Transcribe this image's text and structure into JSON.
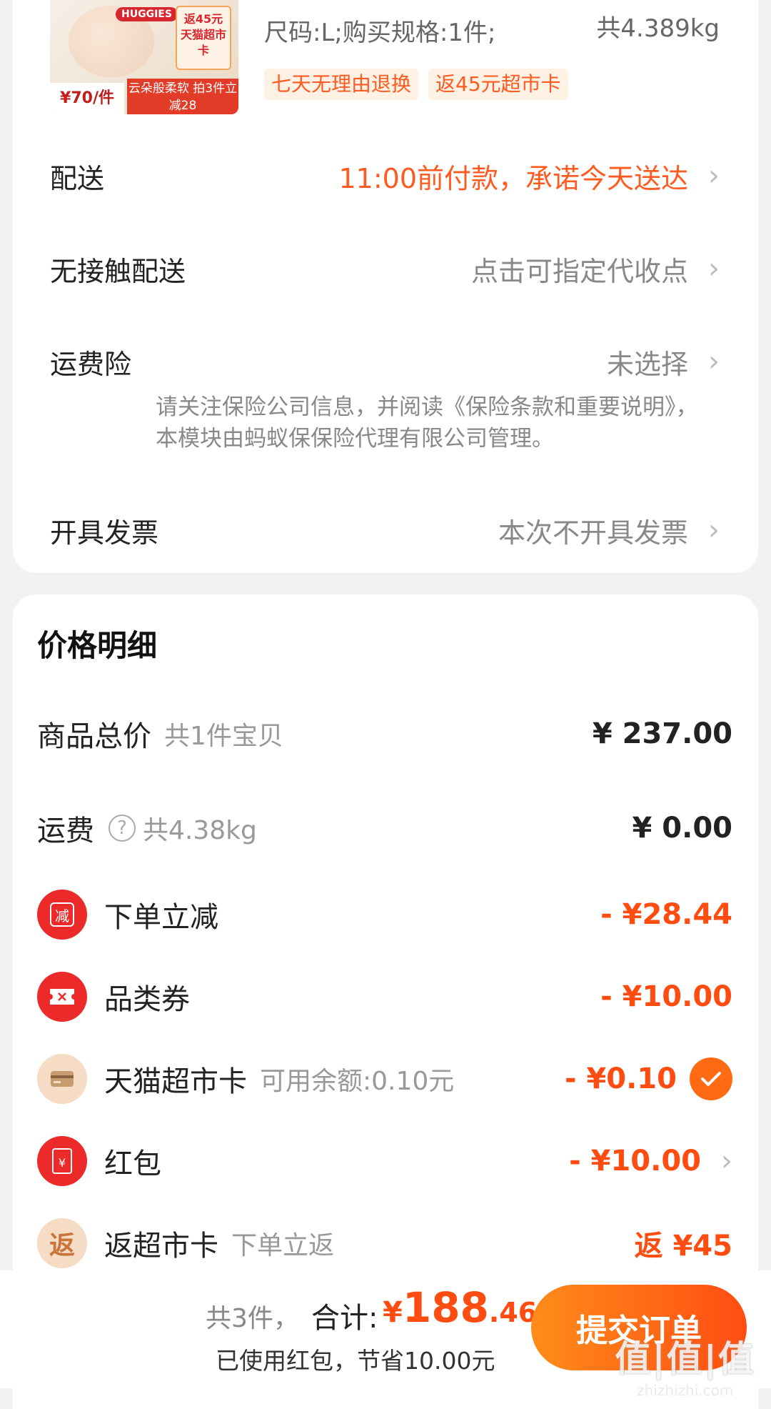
{
  "product": {
    "thumb_brand": "HUGGIES",
    "thumb_promo": "返45元 天猫超市卡",
    "thumb_price": "¥70/件",
    "thumb_ribbon": "云朵般柔软 拍3件立减28",
    "spec": "尺码:L;购买规格:1件;",
    "weight": "共4.389kg",
    "tags": [
      "七天无理由退换",
      "返45元超市卡"
    ]
  },
  "order_options": [
    {
      "label": "配送",
      "value": "11:00前付款，承诺今天送达",
      "accent": true
    },
    {
      "label": "无接触配送",
      "value": "点击可指定代收点",
      "accent": false
    },
    {
      "label": "运费险",
      "value": "未选择",
      "accent": false
    },
    {
      "label": "开具发票",
      "value": "本次不开具发票",
      "accent": false
    }
  ],
  "insurance_notice": "请关注保险公司信息，并阅读《保险条款和重要说明》，本模块由蚂蚁保保险代理有限公司管理。",
  "price_detail": {
    "title": "价格明细",
    "goods_total": {
      "label": "商品总价",
      "sub": "共1件宝贝",
      "amount": "¥ 237.00"
    },
    "shipping": {
      "label": "运费",
      "help_icon": "?",
      "sub": "共4.38kg",
      "amount": "¥ 0.00"
    },
    "discounts": [
      {
        "icon": "减",
        "label": "下单立减",
        "sub": "",
        "amount": "- ¥28.44"
      },
      {
        "icon": "coupon-icon",
        "label": "品类券",
        "sub": "",
        "amount": "- ¥10.00"
      },
      {
        "icon": "card-icon",
        "label": "天猫超市卡",
        "sub": "可用余额:0.10元",
        "amount": "- ¥0.10"
      },
      {
        "icon": "¥",
        "label": "红包",
        "sub": "",
        "amount": "- ¥10.00"
      },
      {
        "icon": "返",
        "label": "返超市卡",
        "sub": "下单立返",
        "amount": "返 ¥45"
      }
    ]
  },
  "bottom_bar": {
    "count": "共3件，",
    "total_label": "合计:",
    "currency": "¥",
    "price_int": "188",
    "price_dec": ".46",
    "saved": "已使用红包，节省10.00元",
    "submit_label": "提交订单"
  },
  "watermark": {
    "big": "值|值|值",
    "small": "zhizhizhi.com"
  },
  "colors": {
    "accent": "#ff4d12",
    "button_start": "#ff8c1a",
    "button_end": "#ff4d12"
  }
}
